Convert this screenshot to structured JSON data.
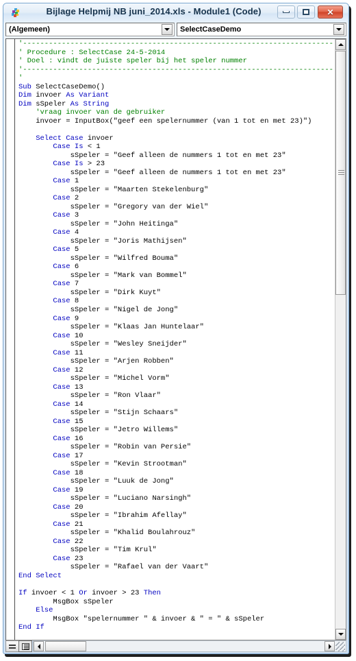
{
  "window": {
    "title": "Bijlage Helpmij NB juni_2014.xls - Module1 (Code)",
    "icon": "vba-module-icon",
    "buttons": {
      "minimize": "minimize-icon",
      "maximize": "restore-icon",
      "close": "✕"
    }
  },
  "toolbar": {
    "object_combo": {
      "value": "(Algemeen)",
      "arrow": "chevron-down-icon"
    },
    "procedure_combo": {
      "value": "SelectCaseDemo",
      "arrow": "chevron-down-icon"
    }
  },
  "code": {
    "language": "vba",
    "colors": {
      "keyword": "#0000c0",
      "comment": "#008000",
      "text": "#000000",
      "background": "#ffffff"
    },
    "lines": [
      {
        "t": "comment",
        "s": "'------------------------------------------------------------------------"
      },
      {
        "t": "comment",
        "s": "' Procedure : SelectCase 24-5-2014"
      },
      {
        "t": "comment",
        "s": "' Doel : vindt de juiste speler bij het speler nummer"
      },
      {
        "t": "comment",
        "s": "'------------------------------------------------------------------------"
      },
      {
        "t": "comment",
        "s": "'"
      },
      {
        "t": "mix",
        "k": "Sub",
        "s": " SelectCaseDemo()"
      },
      {
        "t": "mix",
        "k": "Dim",
        "s": " invoer ",
        "k2": "As Variant"
      },
      {
        "t": "mix",
        "k": "Dim",
        "s": " sSpeler ",
        "k2": "As String"
      },
      {
        "t": "comment",
        "s": "    'vraag invoer van de gebruiker"
      },
      {
        "t": "plain",
        "s": "    invoer = InputBox(\"geef een spelernummer (van 1 tot en met 23)\")"
      },
      {
        "t": "plain",
        "s": ""
      },
      {
        "t": "mix",
        "k": "    Select Case",
        "s": " invoer"
      },
      {
        "t": "mix",
        "k": "        Case Is",
        "s": " < 1"
      },
      {
        "t": "plain",
        "s": "            sSpeler = \"Geef alleen de nummers 1 tot en met 23\""
      },
      {
        "t": "mix",
        "k": "        Case Is",
        "s": " > 23"
      },
      {
        "t": "plain",
        "s": "            sSpeler = \"Geef alleen de nummers 1 tot en met 23\""
      },
      {
        "t": "mix",
        "k": "        Case",
        "s": " 1"
      },
      {
        "t": "plain",
        "s": "            sSpeler = \"Maarten Stekelenburg\""
      },
      {
        "t": "mix",
        "k": "        Case",
        "s": " 2"
      },
      {
        "t": "plain",
        "s": "            sSpeler = \"Gregory van der Wiel\""
      },
      {
        "t": "mix",
        "k": "        Case",
        "s": " 3"
      },
      {
        "t": "plain",
        "s": "            sSpeler = \"John Heitinga\""
      },
      {
        "t": "mix",
        "k": "        Case",
        "s": " 4"
      },
      {
        "t": "plain",
        "s": "            sSpeler = \"Joris Mathijsen\""
      },
      {
        "t": "mix",
        "k": "        Case",
        "s": " 5"
      },
      {
        "t": "plain",
        "s": "            sSpeler = \"Wilfred Bouma\""
      },
      {
        "t": "mix",
        "k": "        Case",
        "s": " 6"
      },
      {
        "t": "plain",
        "s": "            sSpeler = \"Mark van Bommel\""
      },
      {
        "t": "mix",
        "k": "        Case",
        "s": " 7"
      },
      {
        "t": "plain",
        "s": "            sSpeler = \"Dirk Kuyt\""
      },
      {
        "t": "mix",
        "k": "        Case",
        "s": " 8"
      },
      {
        "t": "plain",
        "s": "            sSpeler = \"Nigel de Jong\""
      },
      {
        "t": "mix",
        "k": "        Case",
        "s": " 9"
      },
      {
        "t": "plain",
        "s": "            sSpeler = \"Klaas Jan Huntelaar\""
      },
      {
        "t": "mix",
        "k": "        Case",
        "s": " 10"
      },
      {
        "t": "plain",
        "s": "            sSpeler = \"Wesley Sneijder\""
      },
      {
        "t": "mix",
        "k": "        Case",
        "s": " 11"
      },
      {
        "t": "plain",
        "s": "            sSpeler = \"Arjen Robben\""
      },
      {
        "t": "mix",
        "k": "        Case",
        "s": " 12"
      },
      {
        "t": "plain",
        "s": "            sSpeler = \"Michel Vorm\""
      },
      {
        "t": "mix",
        "k": "        Case",
        "s": " 13"
      },
      {
        "t": "plain",
        "s": "            sSpeler = \"Ron Vlaar\""
      },
      {
        "t": "mix",
        "k": "        Case",
        "s": " 14"
      },
      {
        "t": "plain",
        "s": "            sSpeler = \"Stijn Schaars\""
      },
      {
        "t": "mix",
        "k": "        Case",
        "s": " 15"
      },
      {
        "t": "plain",
        "s": "            sSpeler = \"Jetro Willems\""
      },
      {
        "t": "mix",
        "k": "        Case",
        "s": " 16"
      },
      {
        "t": "plain",
        "s": "            sSpeler = \"Robin van Persie\""
      },
      {
        "t": "mix",
        "k": "        Case",
        "s": " 17"
      },
      {
        "t": "plain",
        "s": "            sSpeler = \"Kevin Strootman\""
      },
      {
        "t": "mix",
        "k": "        Case",
        "s": " 18"
      },
      {
        "t": "plain",
        "s": "            sSpeler = \"Luuk de Jong\""
      },
      {
        "t": "mix",
        "k": "        Case",
        "s": " 19"
      },
      {
        "t": "plain",
        "s": "            sSpeler = \"Luciano Narsingh\""
      },
      {
        "t": "mix",
        "k": "        Case",
        "s": " 20"
      },
      {
        "t": "plain",
        "s": "            sSpeler = \"Ibrahim Afellay\""
      },
      {
        "t": "mix",
        "k": "        Case",
        "s": " 21"
      },
      {
        "t": "plain",
        "s": "            sSpeler = \"Khalid Boulahrouz\""
      },
      {
        "t": "mix",
        "k": "        Case",
        "s": " 22"
      },
      {
        "t": "plain",
        "s": "            sSpeler = \"Tim Krul\""
      },
      {
        "t": "mix",
        "k": "        Case",
        "s": " 23"
      },
      {
        "t": "plain",
        "s": "            sSpeler = \"Rafael van der Vaart\""
      },
      {
        "t": "kw",
        "s": "End Select"
      },
      {
        "t": "plain",
        "s": ""
      },
      {
        "t": "ifline",
        "k": "If",
        "a": " invoer < 1 ",
        "k2": "Or",
        "b": " invoer > 23 ",
        "k3": "Then"
      },
      {
        "t": "plain",
        "s": "        MsgBox sSpeler"
      },
      {
        "t": "kwindent",
        "s": "    Else"
      },
      {
        "t": "plain",
        "s": "        MsgBox \"spelernummer \" & invoer & \" = \" & sSpeler"
      },
      {
        "t": "kw",
        "s": "End If"
      }
    ]
  },
  "scrollbars": {
    "vertical": {
      "up_arrow": "chevron-up-icon",
      "down_arrow": "chevron-down-icon",
      "thumb": "vertical-scroll-thumb"
    },
    "horizontal": {
      "left_arrow": "chevron-left-icon",
      "right_arrow": "chevron-right-icon",
      "thumb": "horizontal-scroll-thumb"
    }
  },
  "view_buttons": {
    "procedure_view": "procedure-view-icon",
    "full_module_view": "full-module-view-icon"
  }
}
